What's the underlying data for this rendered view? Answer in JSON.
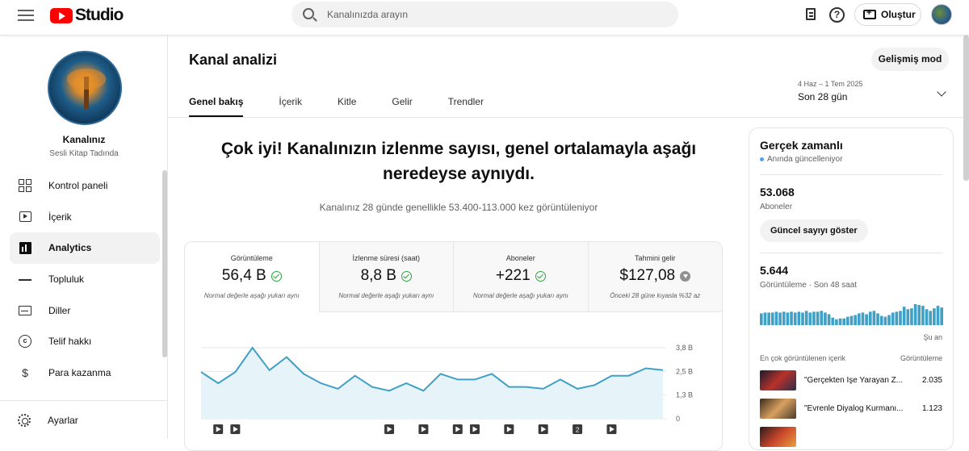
{
  "header": {
    "logo_text": "Studio",
    "search_placeholder": "Kanalınızda arayın",
    "create_label": "Oluştur",
    "help_glyph": "?"
  },
  "sidebar": {
    "channel_label": "Kanalınız",
    "channel_name": "Sesli Kitap Tadında",
    "items": [
      {
        "label": "Kontrol paneli",
        "icon": "dashboard-icon"
      },
      {
        "label": "İçerik",
        "icon": "content-icon"
      },
      {
        "label": "Analytics",
        "icon": "analytics-icon",
        "active": true
      },
      {
        "label": "Topluluk",
        "icon": "community-icon"
      },
      {
        "label": "Diller",
        "icon": "languages-icon"
      },
      {
        "label": "Telif hakkı",
        "icon": "copyright-icon"
      },
      {
        "label": "Para kazanma",
        "icon": "dollar-icon"
      }
    ],
    "settings_label": "Ayarlar"
  },
  "main": {
    "title": "Kanal analizi",
    "advanced_label": "Gelişmiş mod",
    "tabs": [
      "Genel bakış",
      "İçerik",
      "Kitle",
      "Gelir",
      "Trendler"
    ],
    "date_range": {
      "dates": "4 Haz – 1 Tem 2025",
      "label": "Son 28 gün"
    },
    "headline": "Çok iyi! Kanalınızın izlenme sayısı, genel ortalamayla aşağı neredeyse aynıydı.",
    "subline": "Kanalınız 28 günde genellikle 53.400-113.000 kez görüntüleniyor",
    "metrics": [
      {
        "label": "Görüntüleme",
        "value": "56,4 B",
        "note": "Normal değerle aşağı yukarı aynı",
        "icon": "check-circle-icon"
      },
      {
        "label": "İzlenme süresi (saat)",
        "value": "8,8 B",
        "note": "Normal değerle aşağı yukarı aynı",
        "icon": "check-circle-icon"
      },
      {
        "label": "Aboneler",
        "value": "+221",
        "note": "Normal değerle aşağı yukarı aynı",
        "icon": "check-circle-icon"
      },
      {
        "label": "Tahmini gelir",
        "value": "$127,08",
        "note": "Önceki 28 güne kıyasla %32 az",
        "icon": "arrow-down-icon"
      }
    ]
  },
  "chart_data": {
    "type": "area",
    "series": [
      {
        "values": [
          2.5,
          1.9,
          2.5,
          3.8,
          2.6,
          3.3,
          2.4,
          1.9,
          1.6,
          2.3,
          1.7,
          1.5,
          1.9,
          1.5,
          2.4,
          2.1,
          2.1,
          2.4,
          1.7,
          1.7,
          1.6,
          2.1,
          1.6,
          1.8,
          2.3,
          2.3,
          2.7,
          2.6
        ]
      }
    ],
    "y_ticks": [
      "3,8 B",
      "2,5 B",
      "1,3 B",
      "0"
    ],
    "ylim": [
      0,
      3.8
    ],
    "grid": true,
    "line_color": "#41a0c6",
    "fill_color": "#e6f3f9",
    "video_markers": [
      "",
      "",
      "",
      "",
      "",
      "",
      "",
      "",
      "2",
      ""
    ]
  },
  "realtime": {
    "title": "Gerçek zamanlı",
    "subtitle": "Anında güncelleniyor",
    "subscribers": "53.068",
    "subscribers_label": "Aboneler",
    "show_count_label": "Güncel sayıyı göster",
    "views": "5.644",
    "views_label": "Görüntüleme · Son 48 saat",
    "now_label": "Şu an",
    "bar_color": "#41a0c6",
    "bars": [
      14,
      15,
      15,
      15,
      16,
      15,
      16,
      15,
      16,
      15,
      16,
      15,
      17,
      15,
      16,
      16,
      17,
      15,
      13,
      9,
      7,
      8,
      8,
      10,
      11,
      12,
      14,
      15,
      13,
      16,
      17,
      14,
      11,
      10,
      12,
      15,
      16,
      17,
      22,
      19,
      20,
      25,
      24,
      23,
      19,
      17,
      20,
      23,
      21
    ],
    "top_content_label": "En çok görüntülenen içerik",
    "views_col_label": "Görüntüleme",
    "top_videos": [
      {
        "title": "\"Gerçekten İşe Yarayan Z...",
        "views": "2.035"
      },
      {
        "title": "\"Evrenle Diyalog Kurmanı...",
        "views": "1.123"
      }
    ]
  }
}
